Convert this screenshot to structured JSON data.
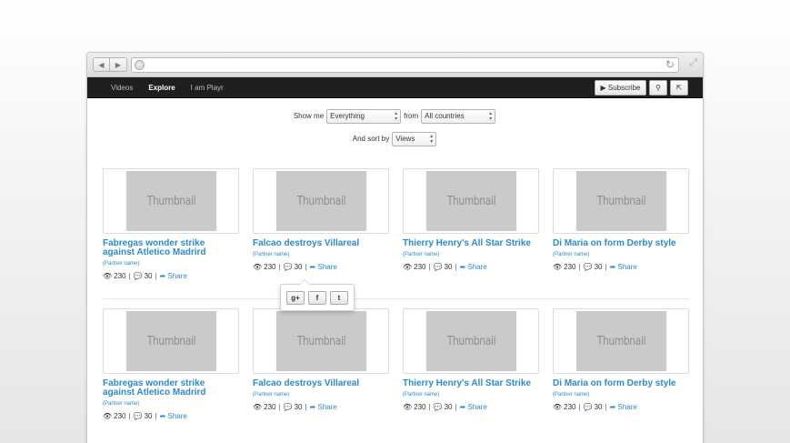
{
  "browser": {
    "back_icon": "◀",
    "forward_icon": "▶",
    "reload_icon": "↻",
    "expand_icon": "⤢"
  },
  "nav": {
    "links": [
      "Videos",
      "Explore",
      "I am Playr"
    ],
    "active": "Explore",
    "subscribe_label": "▶ Subscribe",
    "search_icon": "⚲",
    "share_icon": "⇱"
  },
  "filters": {
    "show_me_label": "Show me",
    "show_me_value": "Everything",
    "from_label": "from",
    "from_value": "All countries",
    "sort_label": "And sort by",
    "sort_value": "Views"
  },
  "videos": [
    {
      "thumb": "Thumbnail",
      "title": "Fabregas wonder strike against Atletico Madrird",
      "partner": "(Partner name)",
      "views": "230",
      "comments": "30",
      "share": "Share"
    },
    {
      "thumb": "Thumbnail",
      "title": "Falcao destroys Villareal",
      "partner": "(Partner name)",
      "views": "230",
      "comments": "30",
      "share": "Share"
    },
    {
      "thumb": "Thumbnail",
      "title": "Thierry Henry's All Star Strike",
      "partner": "(Partner name)",
      "views": "230",
      "comments": "30",
      "share": "Share"
    },
    {
      "thumb": "Thumbnail",
      "title": "Di Maria on form Derby style",
      "partner": "(Partner name)",
      "views": "230",
      "comments": "30",
      "share": "Share"
    },
    {
      "thumb": "Thumbnail",
      "title": "Fabregas wonder strike against Atletico Madrird",
      "partner": "(Partner name)",
      "views": "230",
      "comments": "30",
      "share": "Share"
    },
    {
      "thumb": "Thumbnail",
      "title": "Falcao destroys Villareal",
      "partner": "(Partner name)",
      "views": "230",
      "comments": "30",
      "share": "Share"
    },
    {
      "thumb": "Thumbnail",
      "title": "Thierry Henry's All Star Strike",
      "partner": "(Partner name)",
      "views": "230",
      "comments": "30",
      "share": "Share"
    },
    {
      "thumb": "Thumbnail",
      "title": "Di Maria on form Derby style",
      "partner": "(Partner name)",
      "views": "230",
      "comments": "30",
      "share": "Share"
    }
  ],
  "share_popover": {
    "gplus": "g+",
    "facebook": "f",
    "twitter": "t"
  },
  "colors": {
    "link": "#2a8ad0",
    "nav_bg": "#1f1f1f",
    "thumb_bg": "#cacaca"
  }
}
